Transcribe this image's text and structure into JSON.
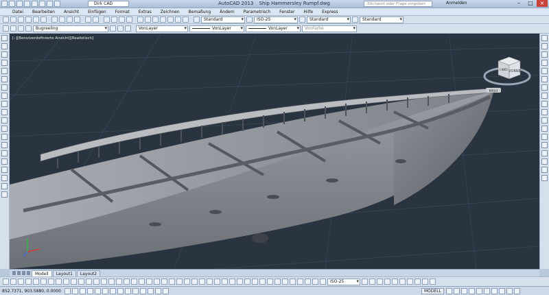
{
  "app": {
    "name": "AutoCAD 2013",
    "file": "Ship Hammersley Rumpf.dwg",
    "workspace": "Dirk CAD",
    "search_placeholder": "Stichwort oder Frage eingeben",
    "login_label": "Anmelden"
  },
  "menu": [
    "Datei",
    "Bearbeiten",
    "Ansicht",
    "Einfügen",
    "Format",
    "Extras",
    "Zeichnen",
    "Bemaßung",
    "Ändern",
    "Parametrisch",
    "Fenster",
    "Hilfe",
    "Express"
  ],
  "styles": {
    "text_style": "Standard",
    "dim_style": "ISO-25",
    "table_style": "Standard",
    "multileader_style": "Standard"
  },
  "layers": {
    "current_layer": "Bugreeling",
    "color": "VonLayer",
    "linetype": "VonLayer",
    "lineweight": "VonLayer",
    "plotstyle": "VonFarbe"
  },
  "viewport": {
    "label": "[–][Benutzerdefinierte Ansicht][Realistisch]",
    "viewcube_face": "VORNE",
    "viewcube_side": "LINKS",
    "tooltip": "MR03"
  },
  "tabs": [
    "Modell",
    "Layout1",
    "Layout2"
  ],
  "bottom_toolbar": {
    "dim_style": "ISO-25"
  },
  "status": {
    "coordinates": "852.7371, 903.5880, 0.0000",
    "model_label": "MODELL"
  },
  "colors": {
    "viewport_bg": "#2a3440",
    "hull": "#8f9399",
    "grid_line": "#3c4a5a"
  }
}
